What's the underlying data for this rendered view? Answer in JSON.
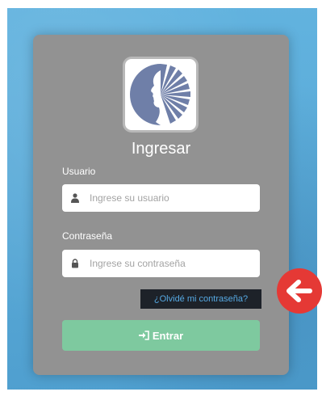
{
  "login": {
    "title": "Ingresar",
    "username_label": "Usuario",
    "username_placeholder": "Ingrese su usuario",
    "password_label": "Contraseña",
    "password_placeholder": "Ingrese su contraseña",
    "forgot_link": "¿Olvidé mi contraseña?",
    "submit_label": "Entrar"
  },
  "icons": {
    "logo": "profile-face-sunburst-logo",
    "user": "user-icon",
    "lock": "lock-icon",
    "submit": "sign-in-icon",
    "annotation": "left-arrow-icon"
  },
  "colors": {
    "card": "#929292",
    "background": "#5fb0dc",
    "submit": "#7ec99f",
    "forgot_bg": "#1d2229",
    "forgot_text": "#56a9e3",
    "annotation": "#e53935"
  }
}
